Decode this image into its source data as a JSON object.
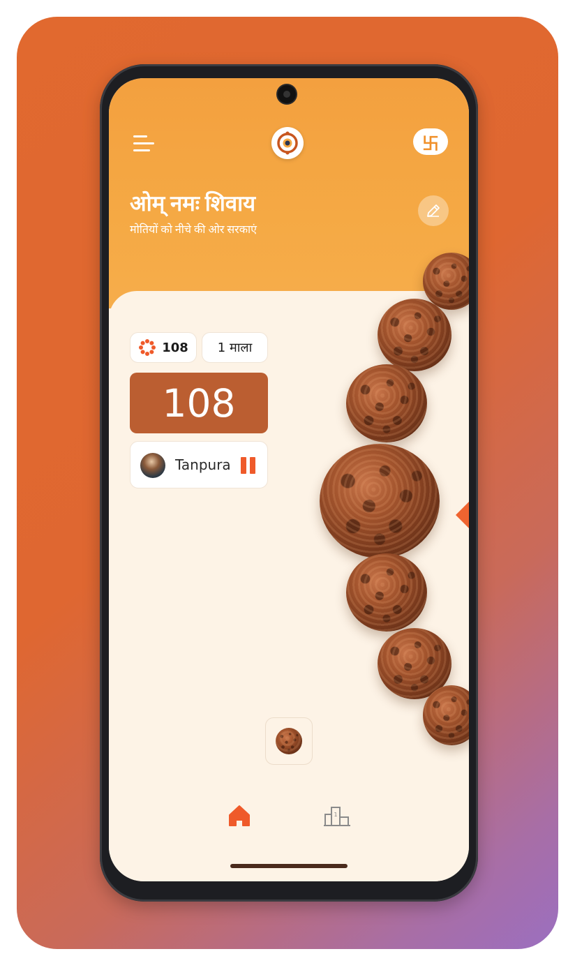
{
  "header": {
    "title": "ओम् नमः शिवाय",
    "subtitle": "मोतियों को नीचे की ओर सरकाएं",
    "swastik_symbol": "卐",
    "menu_icon": "hamburger-menu-icon",
    "logo_icon": "rudraksha-logo-icon",
    "edit_icon": "pencil-icon"
  },
  "stats": {
    "mala_beads": "108",
    "mala_count": "1 माला",
    "counter": "108"
  },
  "music": {
    "track": "Tanpura",
    "state": "playing",
    "control_icon": "pause-icon"
  },
  "nav": {
    "items": [
      {
        "name": "home",
        "icon": "home-icon",
        "active": true
      },
      {
        "name": "stats",
        "icon": "stats-icon",
        "active": false
      }
    ]
  },
  "colors": {
    "accent": "#ef5a2a",
    "header": "#f5a944",
    "counter_bg": "#bb5e31",
    "background": "#fdf3e6"
  }
}
